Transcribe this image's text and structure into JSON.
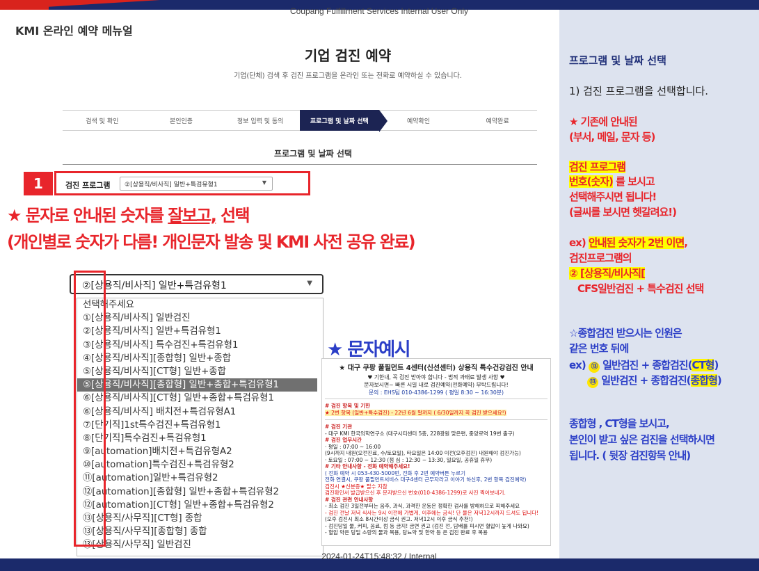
{
  "header": {
    "watermark_top": "Coupang Fulfillment Services Internal User Only",
    "watermark_bottom": "2024-01-24T15:48:32 / Internal",
    "slide_title": "KMI 온라인 예약 메뉴얼"
  },
  "page": {
    "heading": "기업 검진 예약",
    "subheading": "기업(단체) 검색 후 검진 프로그램을 온라인 또는 전화로 예약하실 수 있습니다.",
    "steps": [
      "검색 및 확인",
      "본인인증",
      "정보 입력 및 동의",
      "프로그램 및 날짜 선택",
      "예약확인",
      "예약완료"
    ],
    "active_step": 3,
    "section_title": "프로그램 및 날짜 선택",
    "program_label": "검진 프로그램",
    "program_value": "②[상용직/비사직] 일반+특검유형1",
    "badge": "1"
  },
  "annotation": {
    "line1_pre": "★ 문자로 안내된 숫자를 ",
    "line1_ul": "잘보고,",
    "line1_post": " 선택",
    "line2": "(개인별로 숫자가 다름! 개인문자 발송 및 KMI 사전 공유 완료)"
  },
  "dropdown": {
    "selected_value": "②[상용직/비사직] 일반+특검유형1",
    "items": [
      "선택해주세요",
      "①[상용직/비사직] 일반검진",
      "②[상용직/비사직] 일반+특검유형1",
      "③[상용직/비사직] 특수검진+특검유형1",
      "④[상용직/비사직][종합형] 일반+종합",
      "⑤[상용직/비사직][CT형] 일반+종합",
      "⑤[상용직/비사직][종합형] 일반+종합+특검유형1",
      "⑥[상용직/비사직][CT형] 일반+종합+특검유형1",
      "⑥[상용직/비사직] 배치전+특검유형A1",
      "⑦[단기직]1st특수검진+특검유형1",
      "⑧[단기직]특수검진+특검유형1",
      "⑨[automation]배치전+특검유형A2",
      "⑩[automation]특수검진+특검유형2",
      "⑪[automation]일반+특검유형2",
      "⑫[automation][종합형] 일반+종합+특검유형2",
      "⑫[automation][CT형] 일반+종합+특검유형2",
      "⑬[상용직/사무직][CT형] 종합",
      "⑬[상용직/사무직][종합형] 종합",
      "⑬[상용직/사무직] 일반검진"
    ],
    "selected_index": 6
  },
  "sms_example": {
    "title": "★ 문자예시",
    "head": "★ 대구 쿠팡 풀필먼트 4센터(신선센터) 상용직 특수건강검진 안내",
    "intro1": "♥ 기한내, 꼭 검진 받아야 합니다 - 법적 과태료 발생 사항 ♥",
    "intro2": "문자보시면~ 빠른 시일 내로 검진예약(전화예약) 부탁드립니다!",
    "intro3": "문의 : EHS팀 010-4386-1299 ( 평일 8:30 ~ 16:30분)",
    "sec1_title": "# 검진 항목 및 기한",
    "sec1_line": "★ 2번 항목 (일반+특수검진) - 22년 6월 말까지 ( 6/30일까지 꼭 검진 받으세요!)",
    "sec2_title": "# 검진 기관",
    "sec2_line": "- 대구 KMI 한국의학연구소 (대구시티센터 5층, 228광원 맞은편, 중앙로역 19번 출구)",
    "sec3_title": "# 검진 업무시간",
    "sec3_l1": "· 평일 : 07:00 ~ 16:00",
    "sec3_l2": "(9시까지 내원(오전진료, 수/토요일), 타요일은 14:00 이전(오후검진) 내원해야 검진가능)",
    "sec3_l3": "· 토요일 : 07:00 ~ 12:30 (점 심 : 12:30 ~ 13:30, 일요일, 공휴일 휴무)",
    "sec4_title": "# 기타 안내사항 - 전화 예약해주세요!",
    "sec4_l1": "( 전화 예약 시 053-430-5000번, 전화 후 2번 예약버튼 누르기",
    "sec4_l2": "전화 연결시, 쿠팡 풀필먼트서비스 대구4센터 근무자라고 이야기 하신후, 2번 항목 검진예약)",
    "sec4_l3": "검진시 ★신분증★ 필수 지참",
    "sec4_l4": "검진확인서 발급받으신 후 문자받으신 번호(010-4386-1299)로 사진 찍어보내기.",
    "sec5_title": "# 검진 관련 안내사항",
    "sec5_l1": "- 최소 검진 3일전부터는 음주, 과식, 과격한 운동은 정확한 검사를 방해하므로 피해주세요",
    "sec5_l2": "- 검진 전날 저녁 식사는 9시 이전에 가볍게, 이후에는 금식! 단 물은 저녁12시까지 드셔도 됩니다!",
    "sec5_l3": "(오후 검진시 최소 8시간이상 금식 권고. 저녁12시 이후 금식 추천!)",
    "sec5_l4": "- 검진당일 물, 커피, 음료, 껌 등 금지! 금연 권고 (검진 전, 담배를 피시면 혈압이 높게 나와요)",
    "sec5_l5": "- 혈압 약은 당일 소량의 물과 복용, 당뇨약 및 한약 등 은 검진 완료 후 복용"
  },
  "right_panel": {
    "title": "프로그램 및 날짜 선택",
    "step": "1)  검진 프로그램을 선택합니다.",
    "note1_l1": "★ 기존에 안내된",
    "note1_l2": "(부서, 메일, 문자 등)",
    "note2_l1": "검진 프로그램",
    "note2_l2a": "번호(숫자)",
    "note2_l2b": " 를 보시고",
    "note2_l3": "선택해주시면 됩니다!",
    "note2_l4": "(글씨를 보시면 헷갈려요!)",
    "ex_l1a": "ex) ",
    "ex_l1b": "안내된 숫자가 2번 이면",
    "ex_l1c": ",",
    "ex_l2": "검진프로그램의",
    "ex_l3": "②  [상용직/비사직[",
    "ex_l4": "CFS일반검진 + 특수검진 선택",
    "blue_l1": "☆종합검진 받으시는 인원은",
    "blue_l2": "같은 번호 뒤에",
    "blue_l3a": "ex) ",
    "circle13": "⑬",
    "blue_l3b": " 일반검진 + 종합검진(",
    "blue_l3c": "CT형",
    "blue_l3d": ")",
    "blue_l4b": " 일반검진 + 종합검진(",
    "blue_l4c": "종합형",
    "blue_l4d": ")",
    "blue_l5": "종합형 , CT형을 보시고,",
    "blue_l6": "본인이 받고 싶은 검진을 선택하시면",
    "blue_l7": "됩니다.  ( 뒷장 검진항목 안내)"
  },
  "colors": {
    "accent_red": "#e8252b",
    "navy": "#1b2a6b",
    "blue_text": "#2b3ec7",
    "panel_bg": "#dde3ef"
  }
}
